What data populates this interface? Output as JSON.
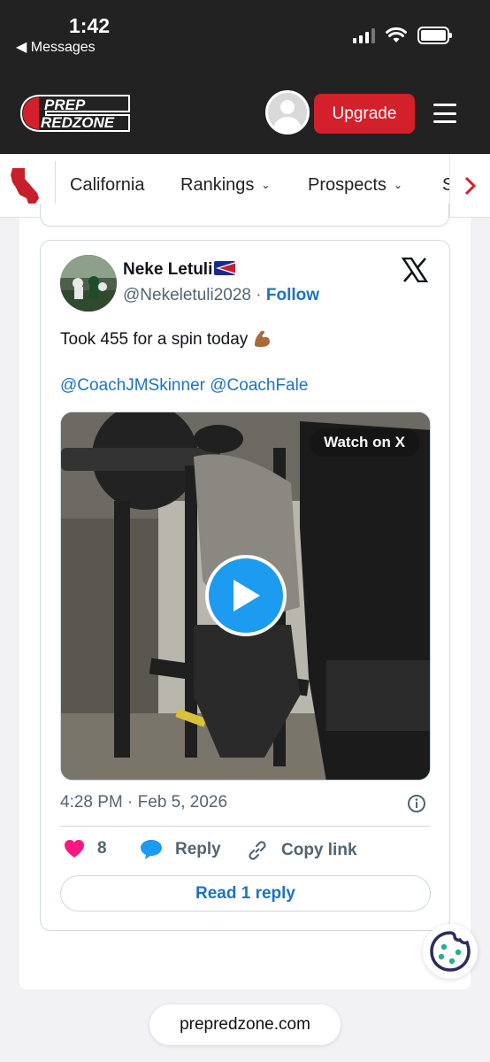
{
  "status_bar": {
    "time": "1:42",
    "back_label": "◀ Messages"
  },
  "header": {
    "logo_top": "PREP",
    "logo_bottom": "REDZONE",
    "upgrade_label": "Upgrade"
  },
  "nav": {
    "state": "California",
    "items": [
      "Rankings",
      "Prospects",
      "S"
    ]
  },
  "tweet": {
    "name": "Neke Letuli",
    "handle": "@Nekeletuli2028",
    "separator": " · ",
    "follow_label": "Follow",
    "text": "Took 455 for a spin today",
    "mentions": "@CoachJMSkinner @CoachFale",
    "watch_label": "Watch on X",
    "timestamp": "4:28 PM · Feb 5, 2026",
    "like_count": "8",
    "reply_label": "Reply",
    "copy_link_label": "Copy link",
    "read_reply_label": "Read 1 reply"
  },
  "footer": {
    "url": "prepredzone.com"
  },
  "colors": {
    "brand_red": "#d4202a",
    "x_blue": "#1d9bf0",
    "link_blue": "#1d72c4",
    "like_pink": "#f91880"
  }
}
